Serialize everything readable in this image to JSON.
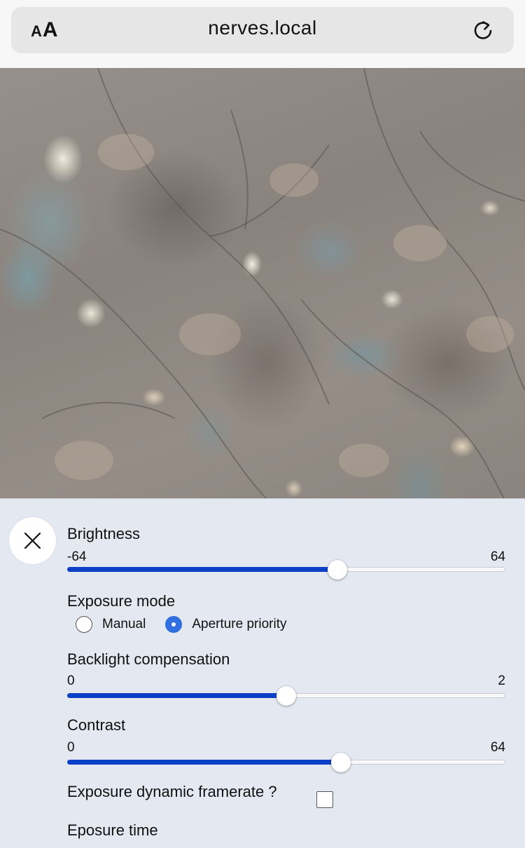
{
  "browser": {
    "text_size_small": "A",
    "text_size_large": "A",
    "url": "nerves.local",
    "reload_icon": "reload-icon"
  },
  "panel": {
    "close_icon": "close-icon",
    "brightness": {
      "label": "Brightness",
      "min": "-64",
      "max": "64",
      "value": 15
    },
    "exposure_mode": {
      "label": "Exposure mode",
      "options": [
        "Manual",
        "Aperture priority"
      ],
      "selected": "Aperture priority"
    },
    "backlight_compensation": {
      "label": "Backlight compensation",
      "min": "0",
      "max": "2",
      "value": 1
    },
    "contrast": {
      "label": "Contrast",
      "min": "0",
      "max": "64",
      "value": 40
    },
    "exposure_dynamic_framerate": {
      "label": "Exposure dynamic framerate ?",
      "checked": false
    },
    "exposure_time": {
      "label": "Eposure time"
    }
  },
  "colors": {
    "slider_fill": "#0b40c7",
    "radio_checked": "#2f6fe0",
    "panel_background": "#e3e8f1"
  }
}
